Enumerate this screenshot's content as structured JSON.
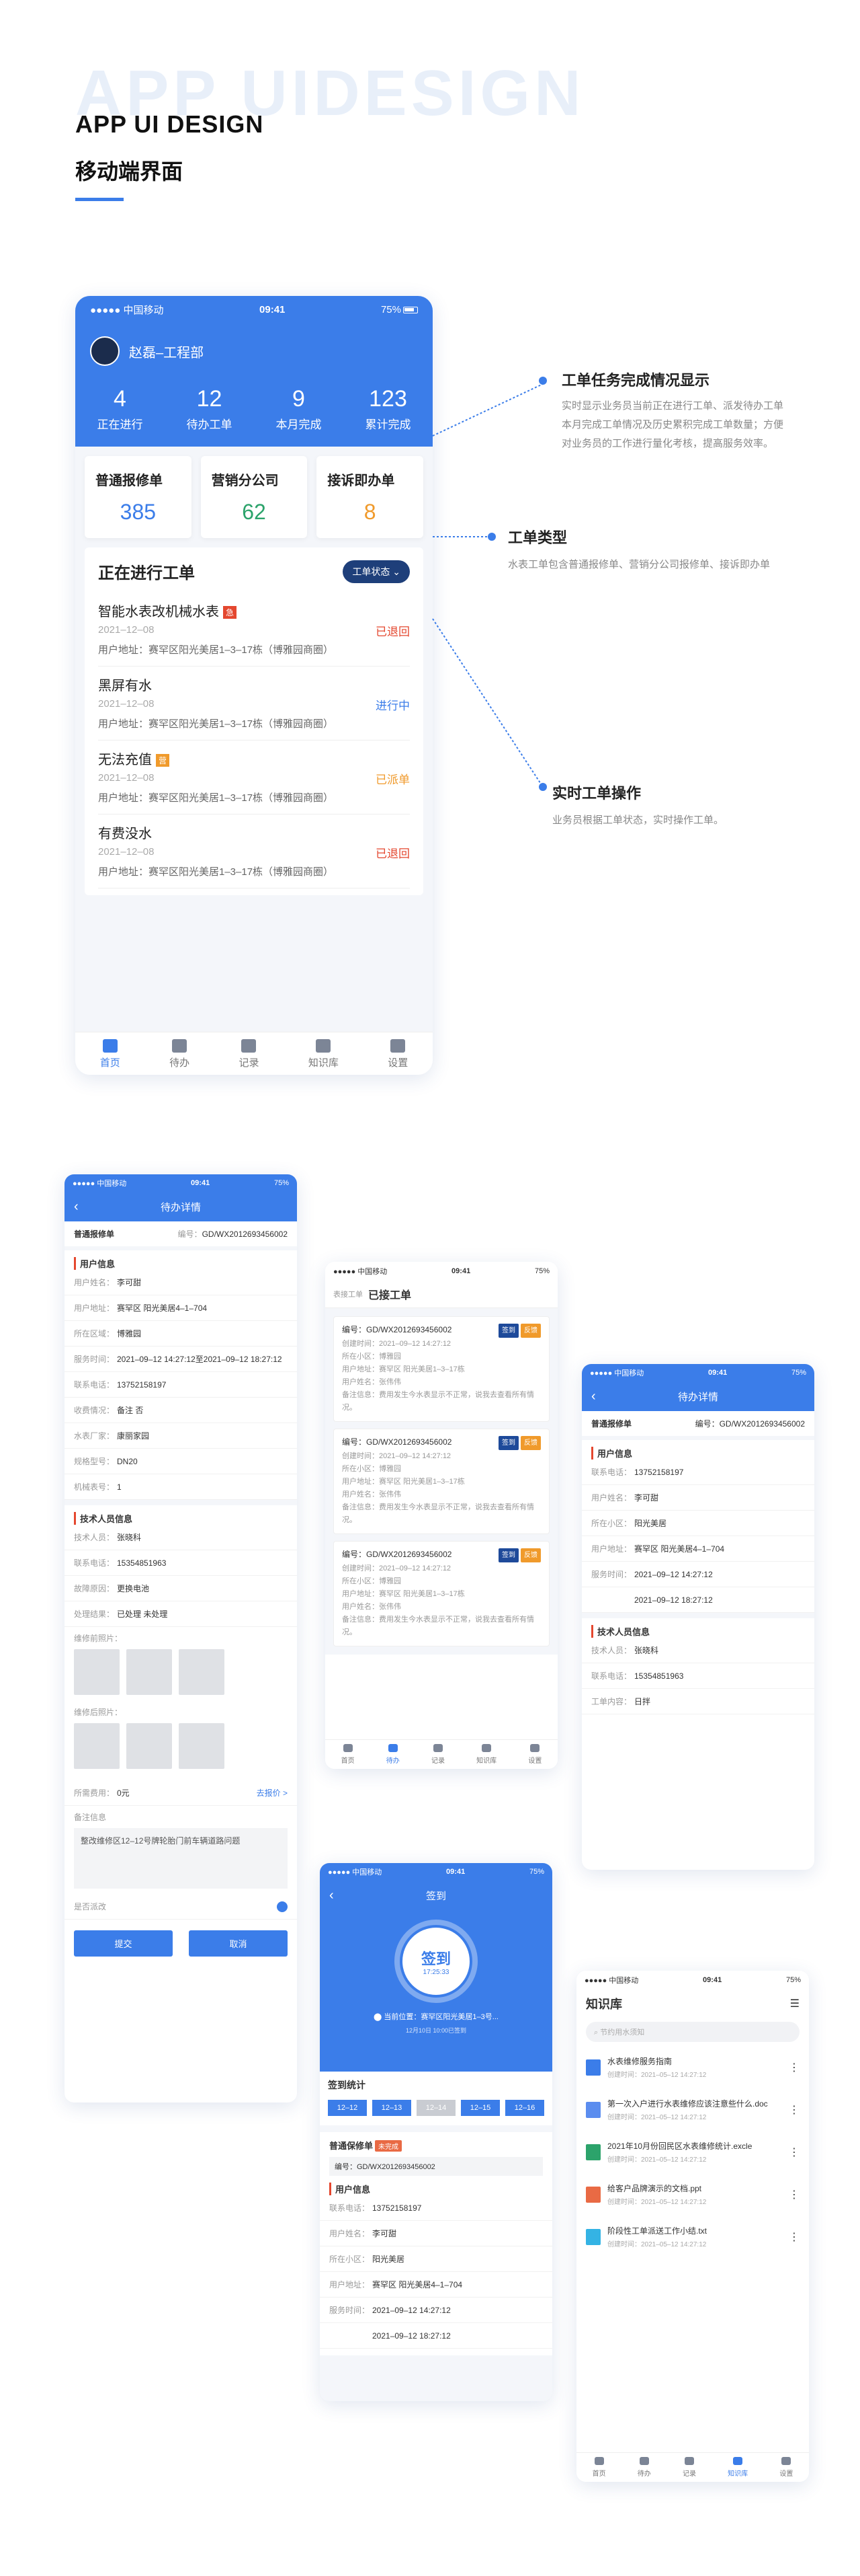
{
  "header": {
    "bg_title": "APP UIDESIGN",
    "title_en": "APP UI DESIGN",
    "title_cn": "移动端界面"
  },
  "home": {
    "status": {
      "carrier": "●●●●● 中国移动",
      "time": "09:41",
      "battery": "75%"
    },
    "user": "赵磊–工程部",
    "stats": [
      {
        "value": "4",
        "label": "正在进行"
      },
      {
        "value": "12",
        "label": "待办工单"
      },
      {
        "value": "9",
        "label": "本月完成"
      },
      {
        "value": "123",
        "label": "累计完成"
      }
    ],
    "types": [
      {
        "label": "普通报修单",
        "value": "385",
        "color": "#3b7de9"
      },
      {
        "label": "营销分公司",
        "value": "62",
        "color": "#2ca36b"
      },
      {
        "label": "接诉即办单",
        "value": "8",
        "color": "#f09a2b"
      }
    ],
    "ongoing_title": "正在进行工单",
    "filter": "工单状态",
    "orders": [
      {
        "name": "智能水表改机械水表",
        "tag": "急",
        "tag_color": "#e4472f",
        "date": "2021–12–08",
        "addr": "用户地址：赛罕区阳光美居1–3–17栋（博雅园商圈）",
        "status": "已退回",
        "status_color": "#e4472f"
      },
      {
        "name": "黑屏有水",
        "tag": "",
        "tag_color": "",
        "date": "2021–12–08",
        "addr": "用户地址：赛罕区阳光美居1–3–17栋（博雅园商圈）",
        "status": "进行中",
        "status_color": "#3b7de9"
      },
      {
        "name": "无法充值",
        "tag": "营",
        "tag_color": "#f09a2b",
        "date": "2021–12–08",
        "addr": "用户地址：赛罕区阳光美居1–3–17栋（博雅园商圈）",
        "status": "已派单",
        "status_color": "#f09a2b"
      },
      {
        "name": "有费没水",
        "tag": "",
        "tag_color": "",
        "date": "2021–12–08",
        "addr": "用户地址：赛罕区阳光美居1–3–17栋（博雅园商圈）",
        "status": "已退回",
        "status_color": "#e4472f"
      }
    ],
    "tabs": [
      "首页",
      "待办",
      "记录",
      "知识库",
      "设置"
    ]
  },
  "annotations": [
    {
      "title": "工单任务完成情况显示",
      "desc": [
        "实时显示业务员当前正在进行工单、派发待办工单",
        "本月完成工单情况及历史累积完成工单数量；方便",
        "对业务员的工作进行量化考核，提高服务效率。"
      ]
    },
    {
      "title": "工单类型",
      "desc": [
        "水表工单包含普通报修单、营销分公司报修单、接诉即办单"
      ]
    },
    {
      "title": "实时工单操作",
      "desc": [
        "业务员根据工单状态，实时操作工单。"
      ]
    }
  ],
  "detail": {
    "status": {
      "carrier": "●●●●● 中国移动",
      "time": "09:41",
      "battery": "75%"
    },
    "title": "待办详情",
    "type": "普通报修单",
    "no_label": "编号：",
    "no": "GD/WX2012693456002",
    "user_sec": "用户信息",
    "rows": [
      [
        "用户姓名：",
        "李可甜"
      ],
      [
        "用户地址：",
        "赛罕区 阳光美居4–1–704"
      ],
      [
        "所在区域：",
        "博雅园"
      ],
      [
        "服务时间：",
        "2021–09–12 14:27:12至2021–09–12 18:27:12"
      ],
      [
        "联系电话：",
        "13752158197"
      ],
      [
        "收费情况：",
        "备注  否"
      ],
      [
        "水表厂家：",
        "康丽家园"
      ],
      [
        "规格型号：",
        "DN20"
      ],
      [
        "机械表号：",
        "1"
      ]
    ],
    "tech_sec": "技术人员信息",
    "tech": [
      [
        "技术人员：",
        "张晓科"
      ],
      [
        "联系电话：",
        "15354851963"
      ],
      [
        "故障原因：",
        "更换电池"
      ],
      [
        "处理结果：",
        "已处理  未处理"
      ]
    ],
    "photo_before": "维修前照片：",
    "photo_after": "维修后照片：",
    "fee_label": "所需费用：",
    "fee": "0元",
    "fee_link": "去报价 >",
    "remark_label": "备注信息",
    "remark": "整改维修区12–12号牌轮胎门前车辆道路问题",
    "switch_label": "是否派改",
    "submit": "提交",
    "cancel": "取消"
  },
  "accepted": {
    "status": {
      "carrier": "●●●●● 中国移动",
      "time": "09:41",
      "battery": "75%"
    },
    "crumb": "表接工单",
    "title": "已接工单",
    "items": [
      {
        "no": "编号：GD/WX2012693456002",
        "l1": "创建时间：2021–09–12 14:27:12",
        "l2": "所在小区：博雅园",
        "l3": "用户地址：赛罕区 阳光美居1–3–17栋",
        "l4": "用户姓名：张伟伟",
        "l5": "备注信息：费用发生今水表显示不正常，说我去查看所有情况。",
        "c1": "签到",
        "c2": "反馈"
      },
      {
        "no": "编号：GD/WX2012693456002",
        "l1": "创建时间：2021–09–12 14:27:12",
        "l2": "所在小区：博雅园",
        "l3": "用户地址：赛罕区 阳光美居1–3–17栋",
        "l4": "用户姓名：张伟伟",
        "l5": "备注信息：费用发生今水表显示不正常，说我去查看所有情况。",
        "c1": "签到",
        "c2": "反馈"
      },
      {
        "no": "编号：GD/WX2012693456002",
        "l1": "创建时间：2021–09–12 14:27:12",
        "l2": "所在小区：博雅园",
        "l3": "用户地址：赛罕区 阳光美居1–3–17栋",
        "l4": "用户姓名：张伟伟",
        "l5": "备注信息：费用发生今水表显示不正常，说我去查看所有情况。",
        "c1": "签到",
        "c2": "反馈"
      }
    ]
  },
  "detail2": {
    "status": {
      "carrier": "●●●●● 中国移动",
      "time": "09:41",
      "battery": "75%"
    },
    "title": "待办详情",
    "type": "普通报修单",
    "no": "编号：GD/WX2012693456002",
    "user_sec": "用户信息",
    "rows": [
      [
        "联系电话：",
        "13752158197"
      ],
      [
        "用户姓名：",
        "李可甜"
      ],
      [
        "所在小区：",
        "阳光美居"
      ],
      [
        "用户地址：",
        "赛罕区 阳光美居4–1–704"
      ],
      [
        "服务时间：",
        "2021–09–12 14:27:12"
      ],
      [
        "",
        "2021–09–12 18:27:12"
      ]
    ],
    "tech_sec": "技术人员信息",
    "tech": [
      [
        "技术人员：",
        "张晓科"
      ],
      [
        "联系电话：",
        "15354851963"
      ],
      [
        "工单内容：",
        "日拌"
      ]
    ]
  },
  "signin": {
    "status": {
      "carrier": "●●●●● 中国移动",
      "time": "09:41",
      "battery": "75%"
    },
    "title": "签到",
    "btn": "签到",
    "btn_time": "17:25:33",
    "loc": "当前位置：赛罕区阳光美居1–3号...",
    "loc_sub": "12月10日 10:00已签到",
    "stat_title": "签到统计",
    "days": [
      "12–12",
      "12–13",
      "12–14",
      "12–15",
      "12–16"
    ],
    "wo_type": "普通保修单",
    "wo_tag": "未完成",
    "wo_no": "编号：GD/WX2012693456002",
    "sec": "用户信息",
    "rows": [
      [
        "联系电话：",
        "13752158197"
      ],
      [
        "用户姓名：",
        "李可甜"
      ],
      [
        "所在小区：",
        "阳光美居"
      ],
      [
        "用户地址：",
        "赛罕区 阳光美居4–1–704"
      ],
      [
        "服务时间：",
        "2021–09–12 14:27:12"
      ],
      [
        "",
        "2021–09–12 18:27:12"
      ]
    ]
  },
  "knowledge": {
    "status": {
      "carrier": "●●●●● 中国移动",
      "time": "09:41",
      "battery": "75%"
    },
    "title": "知识库",
    "search": "节约用水须知",
    "files": [
      {
        "name": "水表维修服务指南",
        "sub": "创建时间：2021–05–12 14:27:12",
        "color": "#3b7de9"
      },
      {
        "name": "第一次入户进行水表维修应该注意些什么.doc",
        "sub": "创建时间：2021–05–12 14:27:12",
        "color": "#5b8def"
      },
      {
        "name": "2021年10月份回民区水表维修统计.excle",
        "sub": "创建时间：2021–05–12 14:27:12",
        "color": "#2ca36b"
      },
      {
        "name": "给客户品牌演示的文档.ppt",
        "sub": "创建时间：2021–05–12 14:27:12",
        "color": "#e96a44"
      },
      {
        "name": "阶段性工单派送工作小结.txt",
        "sub": "创建时间：2021–05–12 14:27:12",
        "color": "#34b3e4"
      }
    ],
    "tabs": [
      "首页",
      "待办",
      "记录",
      "知识库",
      "设置"
    ]
  }
}
